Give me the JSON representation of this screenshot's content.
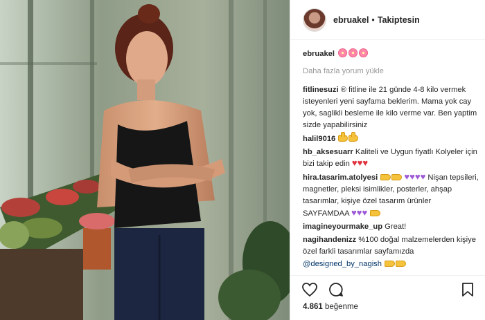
{
  "post": {
    "author": "ebruakel",
    "separator": "•",
    "follow_status": "Takiptesin",
    "caption_user": "ebruakel"
  },
  "load_more": "Daha fazla yorum yükle",
  "comments": [
    {
      "user": "fitlinesuzi",
      "text": "® fitline ile 21 günde 4-8 kilo vermek isteyenleri yeni sayfama beklerim. Mama yok cay yok, saglikli besleme ile kilo verme var. Ben yaptim sizde yapabilirsiniz"
    },
    {
      "user": "halil9016",
      "text": ""
    },
    {
      "user": "hb_aksesuarr",
      "text": "Kaliteli ve Uygun fiyatlı Kolyeler için bizi takip edin"
    },
    {
      "user": "hira.tasarim.atolyesi",
      "text": "Nişan tepsileri, magnetler, pleksi isimlikler, posterler, ahşap tasarımlar, kişiye özel tasarım ürünler SAYFAMDAA"
    },
    {
      "user": "imagineyourmake_up",
      "text": "Great!"
    },
    {
      "user": "nagihandenizz",
      "text": "%100 doğal malzemelerden kişiye özel farkli tasarımlar sayfamızda",
      "mention": "@designed_by_nagish"
    }
  ],
  "likes": {
    "count": "4.861",
    "label": "beğenme"
  }
}
